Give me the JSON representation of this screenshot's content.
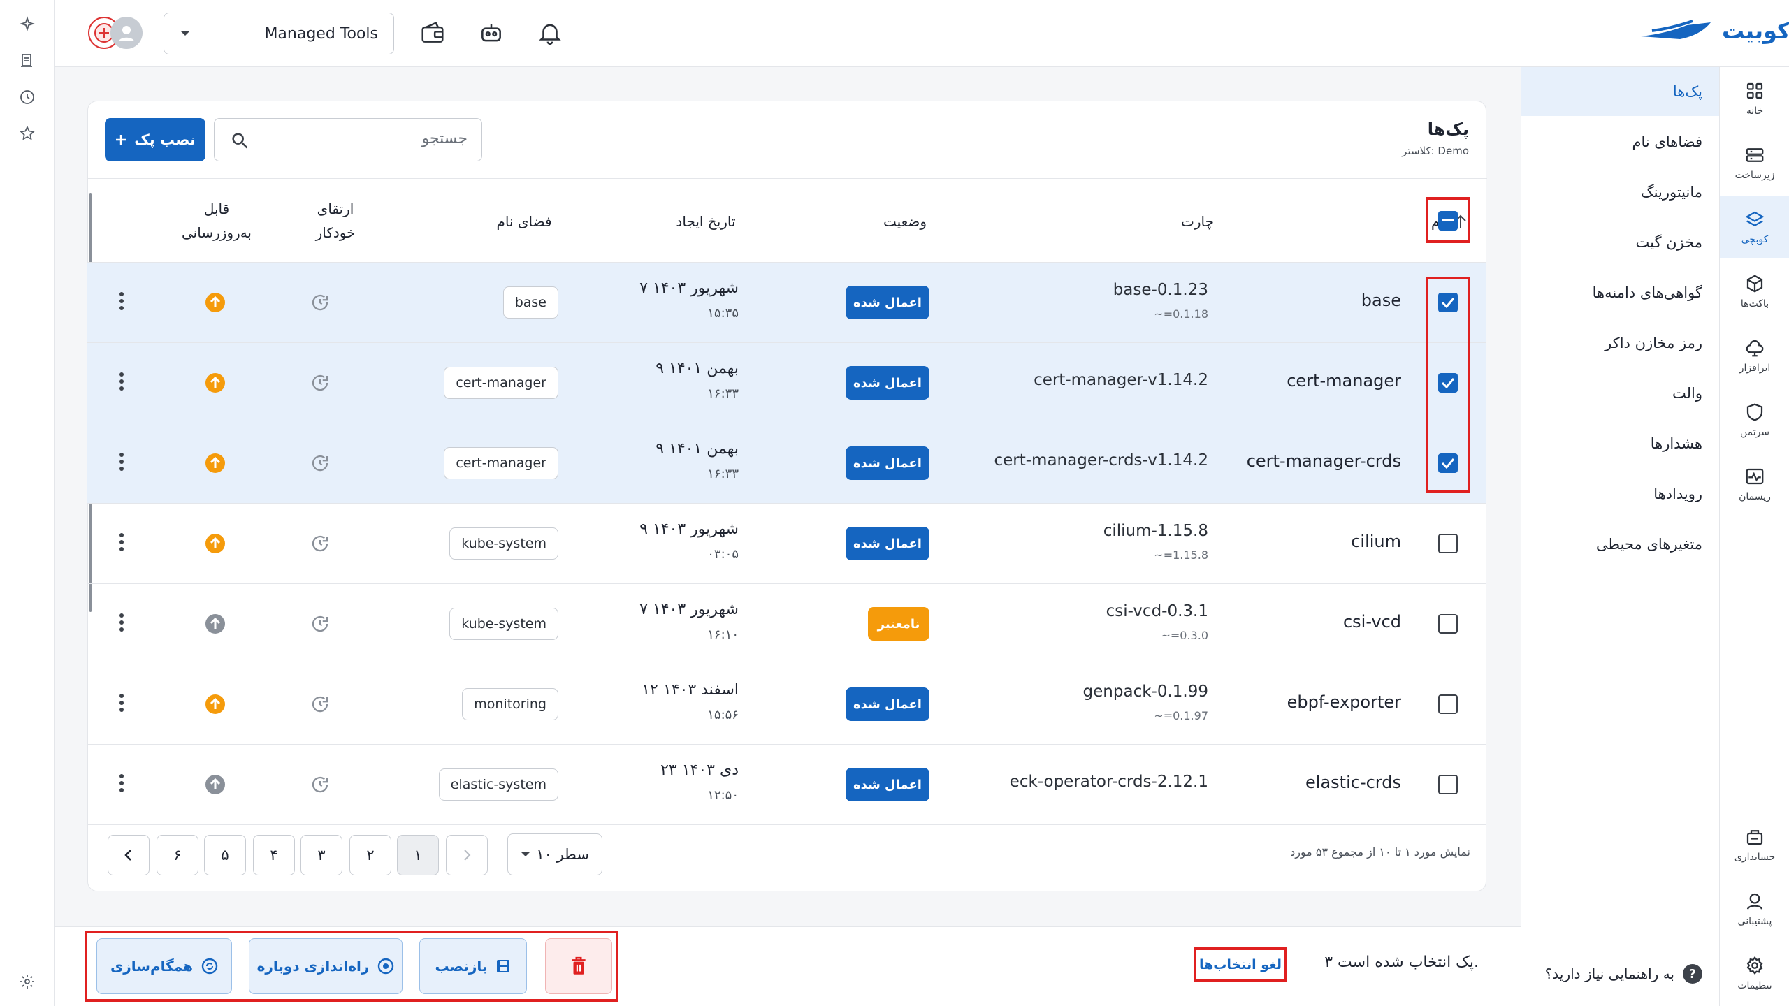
{
  "brand": {
    "name": "کوبیت",
    "color": "#1565c0"
  },
  "header": {
    "org_select": "Managed Tools",
    "icons": [
      "wallet-icon",
      "bot-icon",
      "bell-icon"
    ]
  },
  "rail": {
    "items": [
      {
        "label": "خانه",
        "icon": "grid-icon"
      },
      {
        "label": "زیرساخت",
        "icon": "server-icon"
      },
      {
        "label": "کوبچی",
        "icon": "layers-icon",
        "active": true
      },
      {
        "label": "باکت‌ها",
        "icon": "box-icon"
      },
      {
        "label": "ابرافزار",
        "icon": "cloud-app-icon"
      },
      {
        "label": "سرتمن",
        "icon": "shield-icon"
      },
      {
        "label": "ریسمان",
        "icon": "pulse-icon"
      }
    ],
    "bottom": [
      {
        "label": "حسابداری",
        "icon": "accounting-icon"
      },
      {
        "label": "پشتیبانی",
        "icon": "support-icon"
      },
      {
        "label": "تنظیمات",
        "icon": "settings-icon"
      }
    ]
  },
  "subnav": {
    "items": [
      "پک‌ها",
      "فضاهای نام",
      "مانیتورینگ",
      "مخزن گیت",
      "گواهی‌های دامنه‌ها",
      "رمز مخازن داکر",
      "والت",
      "هشدارها",
      "رویدادها",
      "متغیرهای محیطی"
    ],
    "help": "به راهنمایی نیاز دارید؟"
  },
  "page": {
    "title": "پک‌ها",
    "subtitle": "کلاستر: Demo",
    "search_placeholder": "جستجو",
    "install_button": "نصب پک"
  },
  "table": {
    "headers": {
      "name": "نام",
      "chart": "چارت",
      "status": "وضعیت",
      "created": "تاریخ ایجاد",
      "namespace": "فضای نام",
      "auto_upgrade_1": "ارتقای",
      "auto_upgrade_2": "خودکار",
      "updatable_1": "قابل",
      "updatable_2": "به‌روزرسانی"
    },
    "rows": [
      {
        "name": "base",
        "chart": "base-0.1.23",
        "chart_sub": "~=0.1.18",
        "status": "اعمال شده",
        "status_type": "ok",
        "date": "۷ شهریور ۱۴۰۳",
        "time": "۱۵:۳۵",
        "namespace": "base",
        "selected": true,
        "upgradable": true
      },
      {
        "name": "cert-manager",
        "chart": "cert-manager-v1.14.2",
        "chart_sub": "",
        "status": "اعمال شده",
        "status_type": "ok",
        "date": "۹ بهمن ۱۴۰۱",
        "time": "۱۶:۳۳",
        "namespace": "cert-manager",
        "selected": true,
        "upgradable": true
      },
      {
        "name": "cert-manager-crds",
        "chart": "cert-manager-crds-v1.14.2",
        "chart_sub": "",
        "status": "اعمال شده",
        "status_type": "ok",
        "date": "۹ بهمن ۱۴۰۱",
        "time": "۱۶:۳۳",
        "namespace": "cert-manager",
        "selected": true,
        "upgradable": true
      },
      {
        "name": "cilium",
        "chart": "cilium-1.15.8",
        "chart_sub": "~=1.15.8",
        "status": "اعمال شده",
        "status_type": "ok",
        "date": "۹ شهریور ۱۴۰۳",
        "time": "۰۳:۰۵",
        "namespace": "kube-system",
        "selected": false,
        "upgradable": true
      },
      {
        "name": "csi-vcd",
        "chart": "csi-vcd-0.3.1",
        "chart_sub": "~=0.3.0",
        "status": "نامعتبر",
        "status_type": "warn",
        "date": "۷ شهریور ۱۴۰۳",
        "time": "۱۶:۱۰",
        "namespace": "kube-system",
        "selected": false,
        "upgradable": false
      },
      {
        "name": "ebpf-exporter",
        "chart": "genpack-0.1.99",
        "chart_sub": "~=0.1.97",
        "status": "اعمال شده",
        "status_type": "ok",
        "date": "۱۲ اسفند ۱۴۰۳",
        "time": "۱۵:۵۶",
        "namespace": "monitoring",
        "selected": false,
        "upgradable": true
      },
      {
        "name": "elastic-crds",
        "chart": "eck-operator-crds-2.12.1",
        "chart_sub": "",
        "status": "اعمال شده",
        "status_type": "ok",
        "date": "۲۳ دی ۱۴۰۳",
        "time": "۱۲:۵۰",
        "namespace": "elastic-system",
        "selected": false,
        "upgradable": false
      }
    ]
  },
  "pagination": {
    "summary": "نمایش مورد ۱ تا ۱۰ از مجموع ۵۳ مورد",
    "rows_per_page": "۱۰ سطر",
    "pages": [
      "۱",
      "۲",
      "۳",
      "۴",
      "۵",
      "۶"
    ],
    "current": "۱"
  },
  "selection_bar": {
    "count_text": "۳ پک انتخاب شده است.",
    "clear": "لغو انتخاب‌ها",
    "reinstall": "بازنصب",
    "restart": "راه‌اندازی دوباره",
    "sync": "همگام‌سازی"
  }
}
